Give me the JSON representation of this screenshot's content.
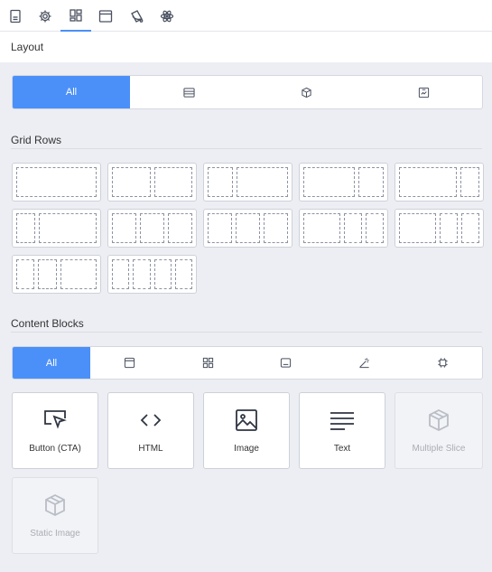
{
  "top_tabs": [
    {
      "icon": "document-icon"
    },
    {
      "icon": "gear-icon"
    },
    {
      "icon": "grid-icon",
      "active": true
    },
    {
      "icon": "browser-window-icon"
    },
    {
      "icon": "paint-bucket-icon"
    },
    {
      "icon": "atom-icon"
    }
  ],
  "layout": {
    "title": "Layout",
    "filters": [
      {
        "label": "All",
        "active": true
      },
      {
        "icon": "rows-icon"
      },
      {
        "icon": "cube-icon"
      },
      {
        "icon": "image-frame-icon"
      }
    ]
  },
  "grid_rows": {
    "title": "Grid Rows",
    "rows": [
      [
        [
          1
        ],
        [
          1,
          1
        ],
        [
          1,
          2
        ],
        [
          2,
          1
        ],
        [
          3,
          1
        ]
      ],
      [
        [
          1,
          3
        ],
        [
          1,
          1,
          1
        ],
        [
          1,
          1,
          1
        ],
        [
          2,
          1,
          1
        ],
        [
          2,
          1,
          1
        ]
      ],
      [
        [
          1,
          1,
          2
        ],
        [
          1,
          1,
          1,
          1
        ]
      ]
    ]
  },
  "content_blocks": {
    "title": "Content Blocks",
    "filters": [
      {
        "label": "All",
        "active": true
      },
      {
        "icon": "window-icon"
      },
      {
        "icon": "grid-four-icon"
      },
      {
        "icon": "banner-icon"
      },
      {
        "icon": "wand-icon"
      },
      {
        "icon": "chip-icon"
      }
    ],
    "blocks": [
      {
        "label": "Button (CTA)",
        "icon": "cursor-click-icon",
        "disabled": false
      },
      {
        "label": "HTML",
        "icon": "code-icon",
        "disabled": false
      },
      {
        "label": "Image",
        "icon": "image-icon",
        "disabled": false
      },
      {
        "label": "Text",
        "icon": "text-lines-icon",
        "disabled": false
      },
      {
        "label": "Multiple Slice",
        "icon": "cube-icon",
        "disabled": true
      },
      {
        "label": "Static Image",
        "icon": "cube-icon",
        "disabled": true
      }
    ]
  },
  "colors": {
    "accent": "#4b90f8",
    "background": "#eceef3"
  }
}
